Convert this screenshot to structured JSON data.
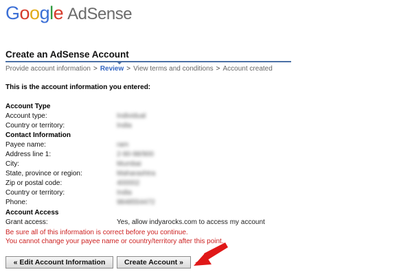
{
  "header": {
    "logo_letters": [
      "G",
      "o",
      "o",
      "g",
      "l",
      "e"
    ],
    "logo_product": "AdSense"
  },
  "page": {
    "title": "Create an AdSense Account",
    "breadcrumb": {
      "step1": "Provide account information",
      "step2": "Review",
      "step3": "View terms and conditions",
      "step4": "Account created",
      "separator": ">"
    },
    "intro": "This is the account information you entered:"
  },
  "account_type": {
    "heading": "Account Type",
    "rows": [
      {
        "label": "Account type:",
        "value": "Individual"
      },
      {
        "label": "Country or territory:",
        "value": "India"
      }
    ]
  },
  "contact": {
    "heading": "Contact Information",
    "rows": [
      {
        "label": "Payee name:",
        "value": "ram"
      },
      {
        "label": "Address line 1:",
        "value": "2-90-98/900"
      },
      {
        "label": "City:",
        "value": "Mumbai"
      },
      {
        "label": "State, province or region:",
        "value": "Maharashtra"
      },
      {
        "label": "Zip or postal code:",
        "value": "400002"
      },
      {
        "label": "Country or territory:",
        "value": "India"
      },
      {
        "label": "Phone:",
        "value": "9848554472"
      }
    ]
  },
  "access": {
    "heading": "Account Access",
    "label": "Grant access:",
    "value": "Yes, allow indyarocks.com to access my account"
  },
  "warnings": {
    "line1": "Be sure all of this information is correct before you continue.",
    "line2": "You cannot change your payee name or country/territory after this point."
  },
  "buttons": {
    "edit": "« Edit Account Information",
    "create": "Create Account »"
  },
  "colors": {
    "link_blue": "#3466c2",
    "warning_red": "#cc1f1f",
    "arrow_red": "#e01818"
  }
}
